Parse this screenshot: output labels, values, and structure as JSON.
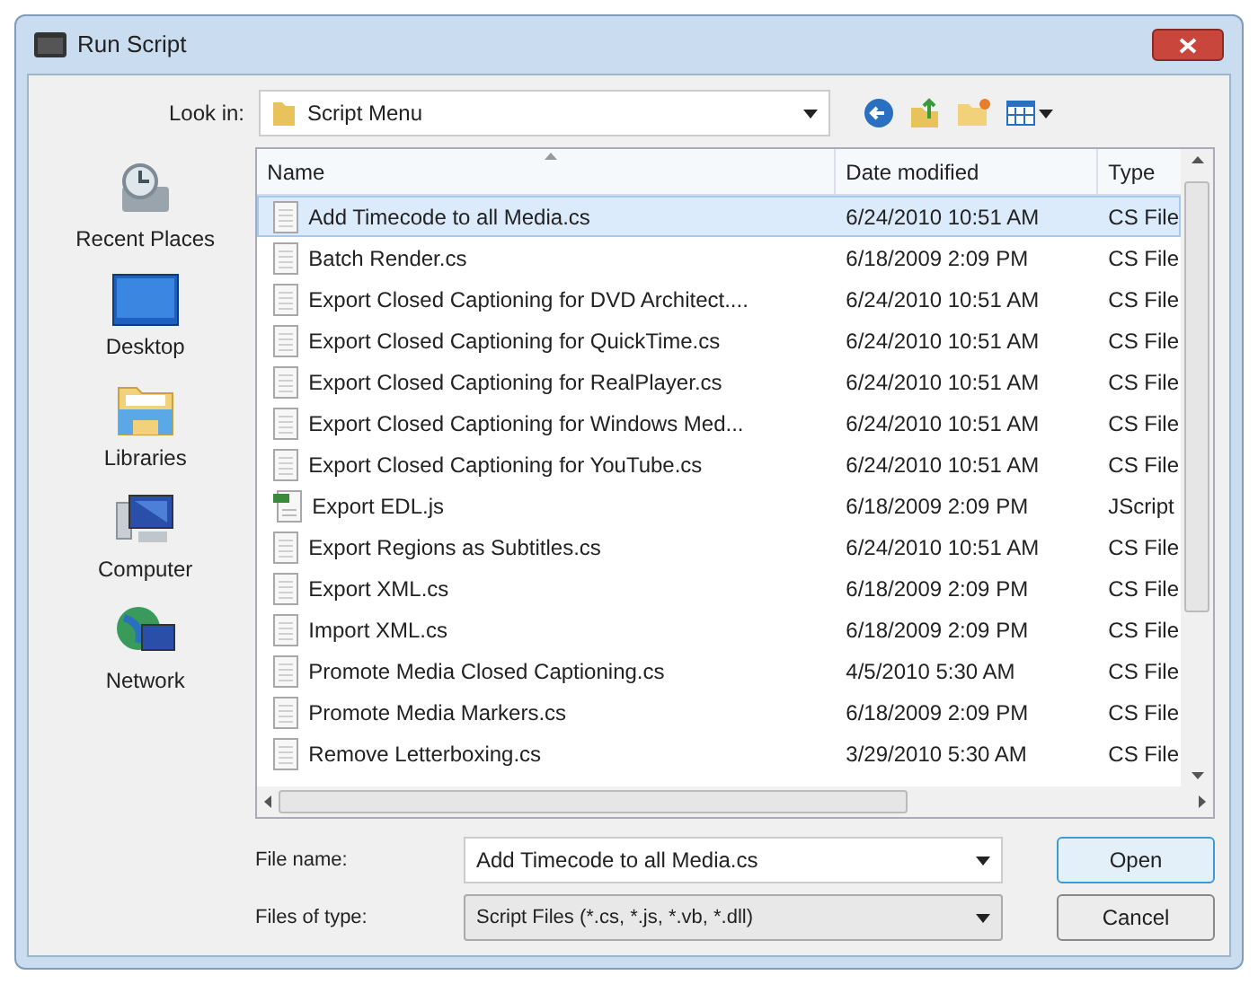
{
  "window": {
    "title": "Run Script"
  },
  "look_in": {
    "label": "Look in:",
    "value": "Script Menu"
  },
  "places": [
    {
      "label": "Recent Places",
      "kind": "recent"
    },
    {
      "label": "Desktop",
      "kind": "desktop"
    },
    {
      "label": "Libraries",
      "kind": "libraries"
    },
    {
      "label": "Computer",
      "kind": "computer"
    },
    {
      "label": "Network",
      "kind": "network"
    }
  ],
  "table": {
    "columns": [
      "Name",
      "Date modified",
      "Type"
    ],
    "rows": [
      {
        "name": "Add Timecode to all Media.cs",
        "date": "6/24/2010 10:51 AM",
        "type": "CS File",
        "kind": "doc",
        "selected": true
      },
      {
        "name": "Batch Render.cs",
        "date": "6/18/2009 2:09 PM",
        "type": "CS File",
        "kind": "doc",
        "selected": false
      },
      {
        "name": "Export Closed Captioning for DVD Architect....",
        "date": "6/24/2010 10:51 AM",
        "type": "CS File",
        "kind": "doc",
        "selected": false
      },
      {
        "name": "Export Closed Captioning for QuickTime.cs",
        "date": "6/24/2010 10:51 AM",
        "type": "CS File",
        "kind": "doc",
        "selected": false
      },
      {
        "name": "Export Closed Captioning for RealPlayer.cs",
        "date": "6/24/2010 10:51 AM",
        "type": "CS File",
        "kind": "doc",
        "selected": false
      },
      {
        "name": "Export Closed Captioning for Windows Med...",
        "date": "6/24/2010 10:51 AM",
        "type": "CS File",
        "kind": "doc",
        "selected": false
      },
      {
        "name": "Export Closed Captioning for YouTube.cs",
        "date": "6/24/2010 10:51 AM",
        "type": "CS File",
        "kind": "doc",
        "selected": false
      },
      {
        "name": "Export EDL.js",
        "date": "6/18/2009 2:09 PM",
        "type": "JScript",
        "kind": "script",
        "selected": false
      },
      {
        "name": "Export Regions as Subtitles.cs",
        "date": "6/24/2010 10:51 AM",
        "type": "CS File",
        "kind": "doc",
        "selected": false
      },
      {
        "name": "Export XML.cs",
        "date": "6/18/2009 2:09 PM",
        "type": "CS File",
        "kind": "doc",
        "selected": false
      },
      {
        "name": "Import XML.cs",
        "date": "6/18/2009 2:09 PM",
        "type": "CS File",
        "kind": "doc",
        "selected": false
      },
      {
        "name": "Promote Media Closed Captioning.cs",
        "date": "4/5/2010 5:30 AM",
        "type": "CS File",
        "kind": "doc",
        "selected": false
      },
      {
        "name": "Promote Media Markers.cs",
        "date": "6/18/2009 2:09 PM",
        "type": "CS File",
        "kind": "doc",
        "selected": false
      },
      {
        "name": "Remove Letterboxing.cs",
        "date": "3/29/2010 5:30 AM",
        "type": "CS File",
        "kind": "doc",
        "selected": false
      }
    ]
  },
  "file_name": {
    "label": "File name:",
    "value": "Add Timecode to all Media.cs"
  },
  "file_type": {
    "label": "Files of type:",
    "value": "Script Files (*.cs, *.js, *.vb, *.dll)"
  },
  "buttons": [
    "Open",
    "Cancel"
  ]
}
